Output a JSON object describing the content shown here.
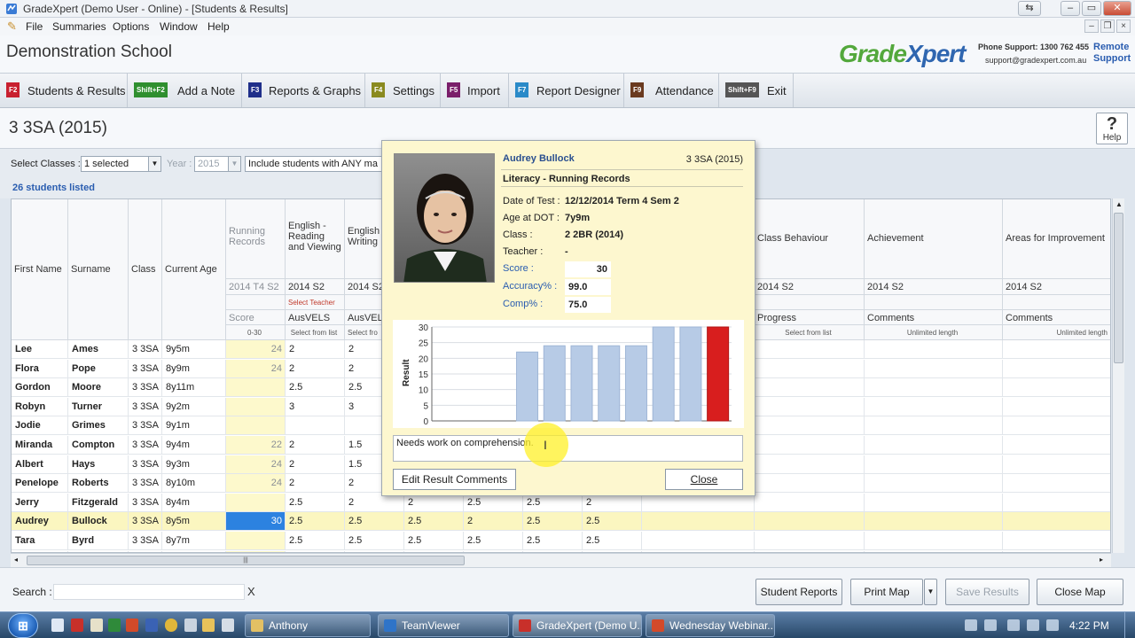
{
  "window": {
    "title": "GradeXpert (Demo User - Online) - [Students & Results]"
  },
  "menu": [
    "File",
    "Summaries",
    "Options",
    "Window",
    "Help"
  ],
  "school": {
    "name": "Demonstration School",
    "logo_green": "Grade",
    "logo_blue": "Xpert",
    "phone": "Phone Support: 1300 762 455",
    "email": "support@gradexpert.com.au",
    "remote_1": "Remote",
    "remote_2": "Support"
  },
  "toolbar": [
    {
      "key": "F2",
      "label": "Students & Results",
      "color": "#c8202f"
    },
    {
      "key": "Shift+F2",
      "label": "Add a Note",
      "color": "#2f8f2f"
    },
    {
      "key": "F3",
      "label": "Reports & Graphs",
      "color": "#1f2f8a"
    },
    {
      "key": "F4",
      "label": "Settings",
      "color": "#8a8a1f"
    },
    {
      "key": "F5",
      "label": "Import",
      "color": "#7a1f6a"
    },
    {
      "key": "F7",
      "label": "Report Designer",
      "color": "#2a8ac8"
    },
    {
      "key": "F9",
      "label": "Attendance",
      "color": "#6a3a1f"
    },
    {
      "key": "Shift+F9",
      "label": "Exit",
      "color": "#555555"
    }
  ],
  "class_title": "3 3SA (2015)",
  "help_label": "Help",
  "filters": {
    "select_classes_label": "Select Classes :",
    "select_classes_value": "1 selected",
    "year_label": "Year :",
    "year_value": "2015",
    "include_text": "Include students with ANY ma",
    "count_text": "26 students listed"
  },
  "grid": {
    "headers": {
      "first_name": "First Name",
      "surname": "Surname",
      "class": "Class",
      "current_age": "Current Age",
      "running_records": "Running Records",
      "english_reading": "English - Reading and Viewing",
      "english_writing": "English Writing",
      "class_behaviour": "Class Behaviour",
      "achievement": "Achievement",
      "areas_improvement": "Areas for Improvement"
    },
    "subheaders": {
      "rr_term": "2014 T4 S2",
      "er_term": "2014 S2",
      "ew_term": "2014 S2",
      "cb_term": "2014 S2",
      "ach_term": "2014 S2",
      "afi_term": "2014 S2",
      "select_teacher": "Select Teacher",
      "score": "Score",
      "ausvels1": "AusVELS",
      "ausvels2": "AusVEL",
      "progress": "Progress",
      "comments1": "Comments",
      "comments2": "Comments",
      "range": "0-30",
      "select_from_list1": "Select from list",
      "select_from_list2": "Select fro",
      "select_from_list3": "Select from list",
      "unlimited1": "Unlimited length",
      "unlimited2": "Unlimited length"
    },
    "rows": [
      {
        "first": "Lee",
        "last": "Ames",
        "class": "3 3SA",
        "age": "9y5m",
        "score": "24",
        "c1": "2",
        "c2": "2",
        "c3": "",
        "c4": "",
        "c5": "",
        "c6": ""
      },
      {
        "first": "Flora",
        "last": "Pope",
        "class": "3 3SA",
        "age": "8y9m",
        "score": "24",
        "c1": "2",
        "c2": "2",
        "c3": "",
        "c4": "",
        "c5": "",
        "c6": ""
      },
      {
        "first": "Gordon",
        "last": "Moore",
        "class": "3 3SA",
        "age": "8y11m",
        "score": "",
        "c1": "2.5",
        "c2": "2.5",
        "c3": "",
        "c4": "",
        "c5": "",
        "c6": ""
      },
      {
        "first": "Robyn",
        "last": "Turner",
        "class": "3 3SA",
        "age": "9y2m",
        "score": "",
        "c1": "3",
        "c2": "3",
        "c3": "",
        "c4": "",
        "c5": "",
        "c6": ""
      },
      {
        "first": "Jodie",
        "last": "Grimes",
        "class": "3 3SA",
        "age": "9y1m",
        "score": "",
        "c1": "",
        "c2": "",
        "c3": "",
        "c4": "",
        "c5": "",
        "c6": ""
      },
      {
        "first": "Miranda",
        "last": "Compton",
        "class": "3 3SA",
        "age": "9y4m",
        "score": "22",
        "c1": "2",
        "c2": "1.5",
        "c3": "",
        "c4": "",
        "c5": "",
        "c6": ""
      },
      {
        "first": "Albert",
        "last": "Hays",
        "class": "3 3SA",
        "age": "9y3m",
        "score": "24",
        "c1": "2",
        "c2": "1.5",
        "c3": "",
        "c4": "",
        "c5": "",
        "c6": ""
      },
      {
        "first": "Penelope",
        "last": "Roberts",
        "class": "3 3SA",
        "age": "8y10m",
        "score": "24",
        "c1": "2",
        "c2": "2",
        "c3": "",
        "c4": "",
        "c5": "",
        "c6": ""
      },
      {
        "first": "Jerry",
        "last": "Fitzgerald",
        "class": "3 3SA",
        "age": "8y4m",
        "score": "",
        "c1": "2.5",
        "c2": "2",
        "c3": "2",
        "c4": "2.5",
        "c5": "2.5",
        "c6": "2"
      },
      {
        "first": "Audrey",
        "last": "Bullock",
        "class": "3 3SA",
        "age": "8y5m",
        "score": "30",
        "c1": "2.5",
        "c2": "2.5",
        "c3": "2.5",
        "c4": "2",
        "c5": "2.5",
        "c6": "2.5"
      },
      {
        "first": "Tara",
        "last": "Byrd",
        "class": "3 3SA",
        "age": "8y7m",
        "score": "",
        "c1": "2.5",
        "c2": "2.5",
        "c3": "2.5",
        "c4": "2.5",
        "c5": "2.5",
        "c6": "2.5"
      }
    ]
  },
  "popup": {
    "student_name": "Audrey Bullock",
    "student_class": "3 3SA (2015)",
    "heading": "Literacy - Running Records",
    "date_label": "Date of Test :",
    "date_value": "12/12/2014 Term 4 Sem 2",
    "age_label": "Age at DOT :",
    "age_value": "7y9m",
    "class_label": "Class :",
    "class_value": "2 2BR (2014)",
    "teacher_label": "Teacher :",
    "teacher_value": "-",
    "score_label": "Score :",
    "score_value": "30",
    "accuracy_label": "Accuracy% :",
    "accuracy_value": "99.0",
    "comp_label": "Comp% :",
    "comp_value": "75.0",
    "comment": "Needs work on comprehension.",
    "edit_button": "Edit Result Comments",
    "close_button": "Close"
  },
  "chart_data": {
    "type": "bar",
    "ylabel": "Result",
    "ylim": [
      0,
      30
    ],
    "yticks": [
      "0",
      "5",
      "10",
      "15",
      "20",
      "25",
      "30"
    ],
    "values": [
      22,
      24,
      24,
      24,
      24,
      30,
      30,
      30
    ],
    "colors": [
      "#b7cbe6",
      "#b7cbe6",
      "#b7cbe6",
      "#b7cbe6",
      "#b7cbe6",
      "#b7cbe6",
      "#b7cbe6",
      "#d81e1e"
    ],
    "grid": true
  },
  "bottom": {
    "search_label": "Search :",
    "clear": "X",
    "student_reports": "Student Reports",
    "print_map": "Print Map",
    "save_results": "Save Results",
    "close_map": "Close Map"
  },
  "taskbar": {
    "tasks": [
      "Anthony",
      "TeamViewer",
      "GradeXpert (Demo U...",
      "Wednesday Webinar..."
    ],
    "clock": "4:22 PM"
  }
}
